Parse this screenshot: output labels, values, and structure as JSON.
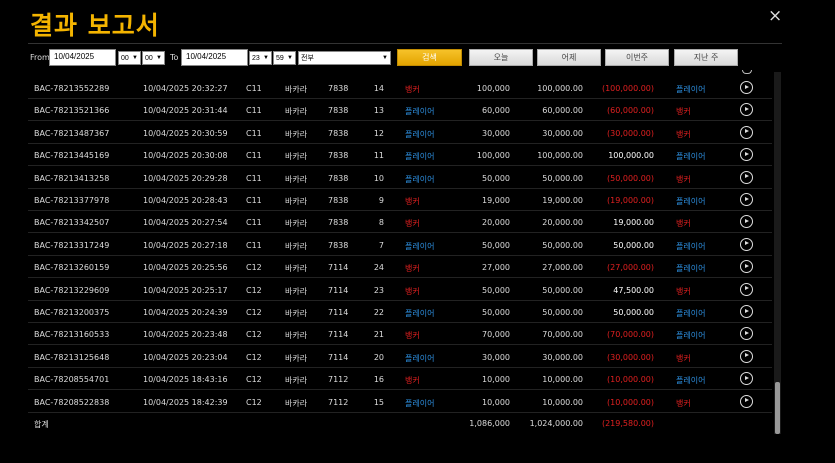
{
  "title": "결과 보고서",
  "close_icon": "×",
  "filters": {
    "from_label": "From",
    "from_date": "10/04/2025",
    "from_hour": "00",
    "from_min": "00",
    "to_label": "To",
    "to_date": "10/04/2025",
    "to_hour": "23",
    "to_min": "59",
    "type": "전부",
    "search": "검색",
    "today": "오늘",
    "yesterday": "어제",
    "this_week": "이번주",
    "last_week": "지난 주"
  },
  "rows": [
    {
      "id": "BAC-78213552289",
      "time": "10/04/2025 20:32:27",
      "table": "C11",
      "game": "바카라",
      "shoe": "7838",
      "round": "14",
      "pick": "뱅커",
      "bet": "100,000",
      "valid": "100,000.00",
      "win": "(100,000.00)",
      "result": "플레이어"
    },
    {
      "id": "BAC-78213521366",
      "time": "10/04/2025 20:31:44",
      "table": "C11",
      "game": "바카라",
      "shoe": "7838",
      "round": "13",
      "pick": "플레이어",
      "bet": "60,000",
      "valid": "60,000.00",
      "win": "(60,000.00)",
      "result": "뱅커"
    },
    {
      "id": "BAC-78213487367",
      "time": "10/04/2025 20:30:59",
      "table": "C11",
      "game": "바카라",
      "shoe": "7838",
      "round": "12",
      "pick": "플레이어",
      "bet": "30,000",
      "valid": "30,000.00",
      "win": "(30,000.00)",
      "result": "뱅커"
    },
    {
      "id": "BAC-78213445169",
      "time": "10/04/2025 20:30:08",
      "table": "C11",
      "game": "바카라",
      "shoe": "7838",
      "round": "11",
      "pick": "플레이어",
      "bet": "100,000",
      "valid": "100,000.00",
      "win": "100,000.00",
      "result": "플레이어"
    },
    {
      "id": "BAC-78213413258",
      "time": "10/04/2025 20:29:28",
      "table": "C11",
      "game": "바카라",
      "shoe": "7838",
      "round": "10",
      "pick": "플레이어",
      "bet": "50,000",
      "valid": "50,000.00",
      "win": "(50,000.00)",
      "result": "뱅커"
    },
    {
      "id": "BAC-78213377978",
      "time": "10/04/2025 20:28:43",
      "table": "C11",
      "game": "바카라",
      "shoe": "7838",
      "round": "9",
      "pick": "뱅커",
      "bet": "19,000",
      "valid": "19,000.00",
      "win": "(19,000.00)",
      "result": "플레이어"
    },
    {
      "id": "BAC-78213342507",
      "time": "10/04/2025 20:27:54",
      "table": "C11",
      "game": "바카라",
      "shoe": "7838",
      "round": "8",
      "pick": "뱅커",
      "bet": "20,000",
      "valid": "20,000.00",
      "win": "19,000.00",
      "result": "뱅커"
    },
    {
      "id": "BAC-78213317249",
      "time": "10/04/2025 20:27:18",
      "table": "C11",
      "game": "바카라",
      "shoe": "7838",
      "round": "7",
      "pick": "플레이어",
      "bet": "50,000",
      "valid": "50,000.00",
      "win": "50,000.00",
      "result": "플레이어"
    },
    {
      "id": "BAC-78213260159",
      "time": "10/04/2025 20:25:56",
      "table": "C12",
      "game": "바카라",
      "shoe": "7114",
      "round": "24",
      "pick": "뱅커",
      "bet": "27,000",
      "valid": "27,000.00",
      "win": "(27,000.00)",
      "result": "플레이어"
    },
    {
      "id": "BAC-78213229609",
      "time": "10/04/2025 20:25:17",
      "table": "C12",
      "game": "바카라",
      "shoe": "7114",
      "round": "23",
      "pick": "뱅커",
      "bet": "50,000",
      "valid": "50,000.00",
      "win": "47,500.00",
      "result": "뱅커"
    },
    {
      "id": "BAC-78213200375",
      "time": "10/04/2025 20:24:39",
      "table": "C12",
      "game": "바카라",
      "shoe": "7114",
      "round": "22",
      "pick": "플레이어",
      "bet": "50,000",
      "valid": "50,000.00",
      "win": "50,000.00",
      "result": "플레이어"
    },
    {
      "id": "BAC-78213160533",
      "time": "10/04/2025 20:23:48",
      "table": "C12",
      "game": "바카라",
      "shoe": "7114",
      "round": "21",
      "pick": "뱅커",
      "bet": "70,000",
      "valid": "70,000.00",
      "win": "(70,000.00)",
      "result": "플레이어"
    },
    {
      "id": "BAC-78213125648",
      "time": "10/04/2025 20:23:04",
      "table": "C12",
      "game": "바카라",
      "shoe": "7114",
      "round": "20",
      "pick": "플레이어",
      "bet": "30,000",
      "valid": "30,000.00",
      "win": "(30,000.00)",
      "result": "뱅커"
    },
    {
      "id": "BAC-78208554701",
      "time": "10/04/2025 18:43:16",
      "table": "C12",
      "game": "바카라",
      "shoe": "7112",
      "round": "16",
      "pick": "뱅커",
      "bet": "10,000",
      "valid": "10,000.00",
      "win": "(10,000.00)",
      "result": "플레이어"
    },
    {
      "id": "BAC-78208522838",
      "time": "10/04/2025 18:42:39",
      "table": "C12",
      "game": "바카라",
      "shoe": "7112",
      "round": "15",
      "pick": "플레이어",
      "bet": "10,000",
      "valid": "10,000.00",
      "win": "(10,000.00)",
      "result": "뱅커"
    }
  ],
  "total": {
    "label": "합계",
    "bet": "1,086,000",
    "valid": "1,024,000.00",
    "win": "(219,580.00)"
  },
  "colors": {
    "title": "#f4b400",
    "banker": "#e02020",
    "player": "#2d8fe0",
    "loss": "#e02020"
  },
  "icons": {
    "play": "play-circle-icon",
    "close": "close-icon",
    "caret": "chevron-down-icon"
  }
}
